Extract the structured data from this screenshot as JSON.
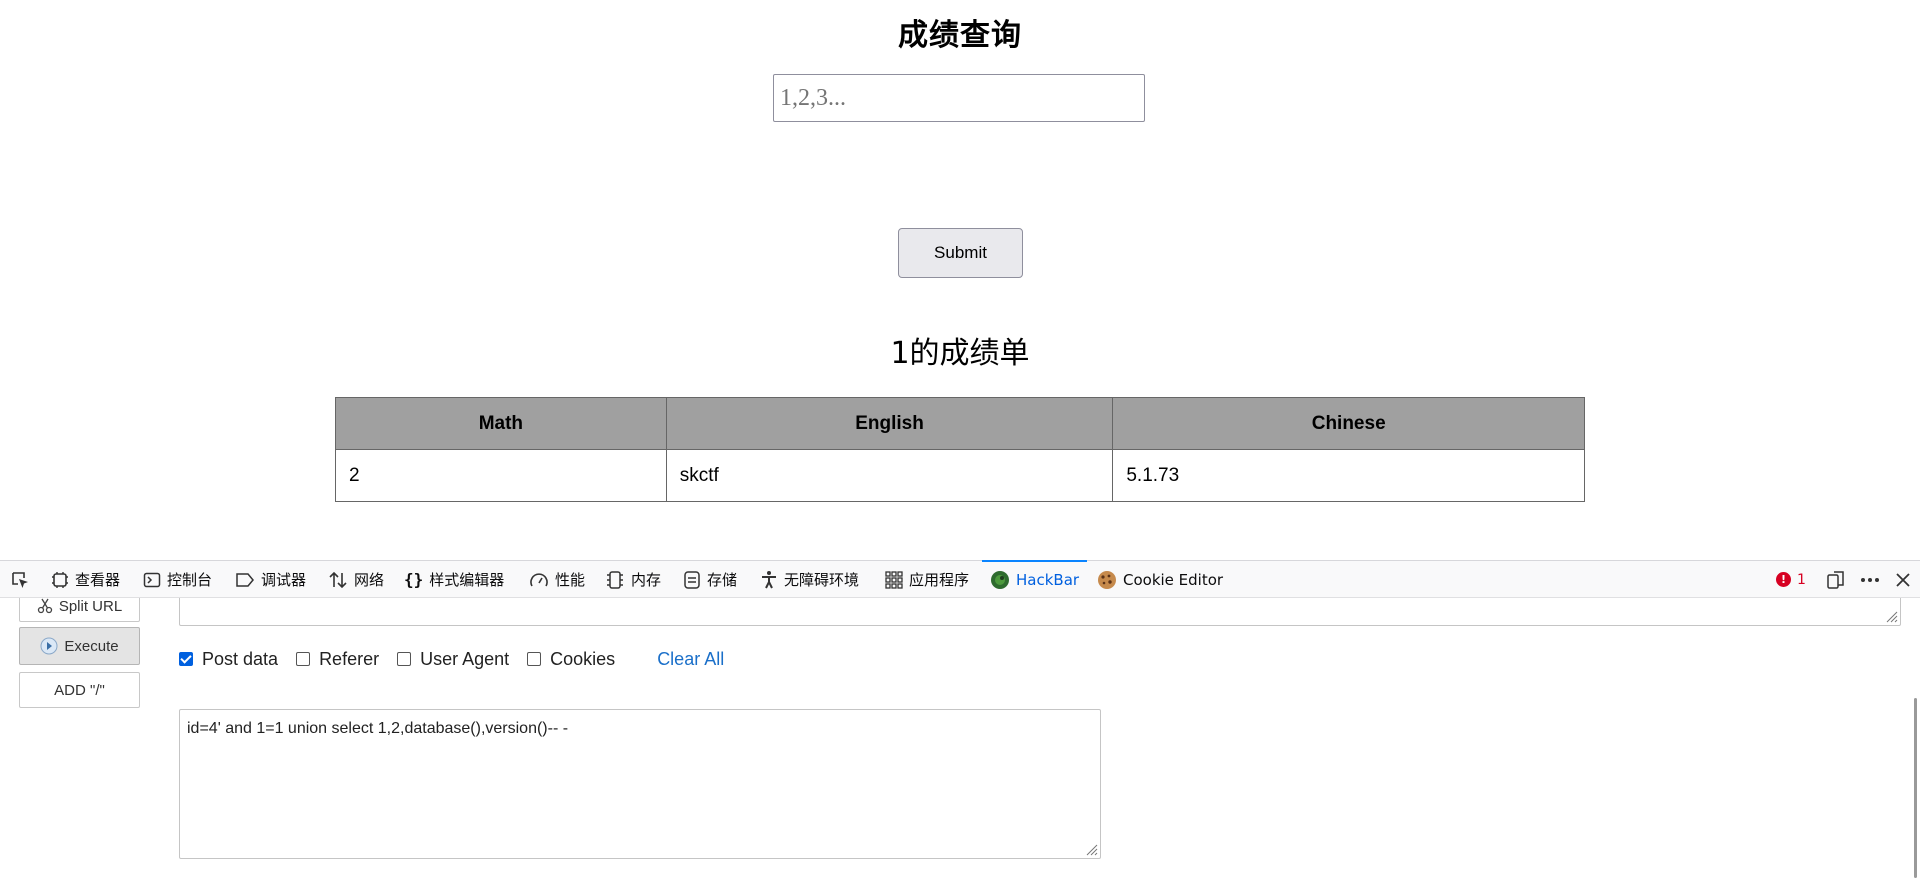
{
  "page": {
    "title": "成绩查询",
    "search": {
      "placeholder": "1,2,3...",
      "value": ""
    },
    "submit_label": "Submit",
    "result_heading": "1的成绩单",
    "table": {
      "headers": [
        "Math",
        "English",
        "Chinese"
      ],
      "rows": [
        [
          "2",
          "skctf",
          "5.1.73"
        ]
      ]
    }
  },
  "devtools": {
    "tabs": [
      {
        "label": "查看器",
        "icon": "inspector-icon"
      },
      {
        "label": "控制台",
        "icon": "console-icon"
      },
      {
        "label": "调试器",
        "icon": "debugger-icon"
      },
      {
        "label": "网络",
        "icon": "network-icon"
      },
      {
        "label": "样式编辑器",
        "icon": "style-editor-icon"
      },
      {
        "label": "性能",
        "icon": "performance-icon"
      },
      {
        "label": "内存",
        "icon": "memory-icon"
      },
      {
        "label": "存储",
        "icon": "storage-icon"
      },
      {
        "label": "无障碍环境",
        "icon": "accessibility-icon"
      },
      {
        "label": "应用程序",
        "icon": "application-icon"
      },
      {
        "label": "HackBar",
        "icon": "hackbar-icon",
        "active": true
      },
      {
        "label": "Cookie Editor",
        "icon": "cookie-icon"
      }
    ],
    "error_count": "1",
    "accent_color": "#0a84ff"
  },
  "hackbar": {
    "split_url_label": "Split URL",
    "execute_label": "Execute",
    "add_slash_label": "ADD \"/\"",
    "options": [
      {
        "label": "Post data",
        "checked": true
      },
      {
        "label": "Referer",
        "checked": false
      },
      {
        "label": "User Agent",
        "checked": false
      },
      {
        "label": "Cookies",
        "checked": false
      }
    ],
    "clear_all_label": "Clear All",
    "post_data": "id=4' and 1=1 union select 1,2,database(),version()-- -"
  }
}
